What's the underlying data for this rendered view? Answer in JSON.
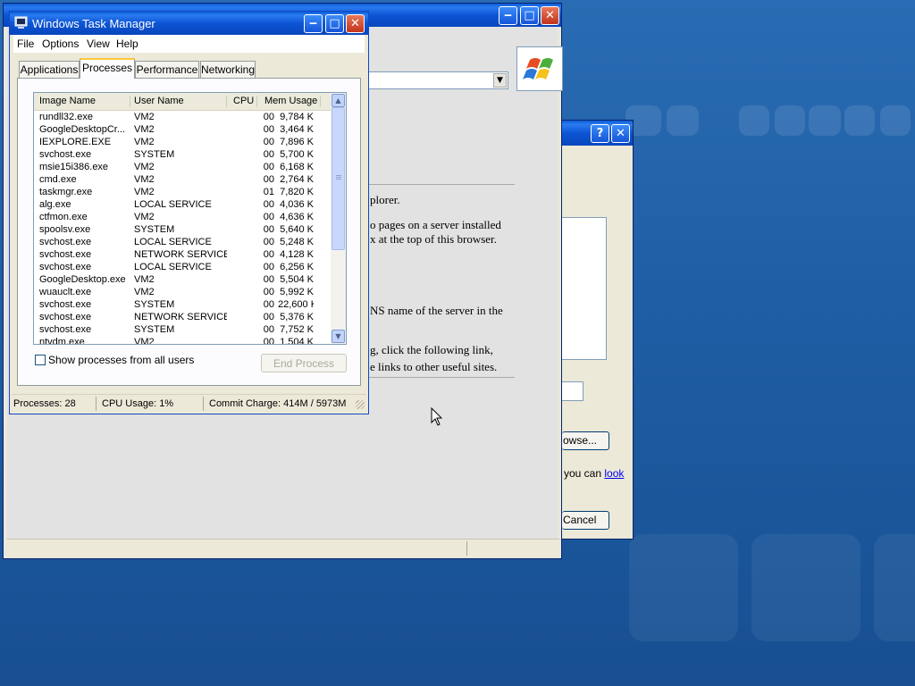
{
  "task_manager": {
    "title": "Windows Task Manager",
    "menu": [
      "File",
      "Options",
      "View",
      "Help"
    ],
    "tabs": [
      "Applications",
      "Processes",
      "Performance",
      "Networking"
    ],
    "active_tab": "Processes",
    "columns": [
      "Image Name",
      "User Name",
      "CPU",
      "Mem Usage"
    ],
    "processes": [
      {
        "name": "rundll32.exe",
        "user": "VM2",
        "cpu": "00",
        "mem": "9,784 K"
      },
      {
        "name": "GoogleDesktopCr...",
        "user": "VM2",
        "cpu": "00",
        "mem": "3,464 K"
      },
      {
        "name": "IEXPLORE.EXE",
        "user": "VM2",
        "cpu": "00",
        "mem": "7,896 K"
      },
      {
        "name": "svchost.exe",
        "user": "SYSTEM",
        "cpu": "00",
        "mem": "5,700 K"
      },
      {
        "name": "msie15i386.exe",
        "user": "VM2",
        "cpu": "00",
        "mem": "6,168 K"
      },
      {
        "name": "cmd.exe",
        "user": "VM2",
        "cpu": "00",
        "mem": "2,764 K"
      },
      {
        "name": "taskmgr.exe",
        "user": "VM2",
        "cpu": "01",
        "mem": "7,820 K"
      },
      {
        "name": "alg.exe",
        "user": "LOCAL SERVICE",
        "cpu": "00",
        "mem": "4,036 K"
      },
      {
        "name": "ctfmon.exe",
        "user": "VM2",
        "cpu": "00",
        "mem": "4,636 K"
      },
      {
        "name": "spoolsv.exe",
        "user": "SYSTEM",
        "cpu": "00",
        "mem": "5,640 K"
      },
      {
        "name": "svchost.exe",
        "user": "LOCAL SERVICE",
        "cpu": "00",
        "mem": "5,248 K"
      },
      {
        "name": "svchost.exe",
        "user": "NETWORK SERVICE",
        "cpu": "00",
        "mem": "4,128 K"
      },
      {
        "name": "svchost.exe",
        "user": "LOCAL SERVICE",
        "cpu": "00",
        "mem": "6,256 K"
      },
      {
        "name": "GoogleDesktop.exe",
        "user": "VM2",
        "cpu": "00",
        "mem": "5,504 K"
      },
      {
        "name": "wuauclt.exe",
        "user": "VM2",
        "cpu": "00",
        "mem": "5,992 K"
      },
      {
        "name": "svchost.exe",
        "user": "SYSTEM",
        "cpu": "00",
        "mem": "22,600 K"
      },
      {
        "name": "svchost.exe",
        "user": "NETWORK SERVICE",
        "cpu": "00",
        "mem": "5,376 K"
      },
      {
        "name": "svchost.exe",
        "user": "SYSTEM",
        "cpu": "00",
        "mem": "7,752 K"
      },
      {
        "name": "ntvdm.exe",
        "user": "VM2",
        "cpu": "00",
        "mem": "1,504 K"
      }
    ],
    "show_all_users_label": "Show processes from all users",
    "show_all_users_checked": false,
    "end_process_label": "End Process",
    "status": {
      "processes": "Processes: 28",
      "cpu_usage": "CPU Usage: 1%",
      "commit_charge": "Commit Charge: 414M / 5973M"
    }
  },
  "browser_window": {
    "text_lines": [
      "plorer.",
      "o pages on a server installed",
      "x at the top of this browser.",
      "NS name of the server in the",
      "g, click the following link,",
      "e links to other useful sites."
    ]
  },
  "dialog": {
    "help_glyph": "?",
    "close_glyph": "✕",
    "browse_label": "owse...",
    "link_prefix": "you can ",
    "link_text": "look",
    "cancel_label": "Cancel"
  },
  "colors": {
    "titlebar_blue": "#0c55d4",
    "desktop_blue": "#1f5fa6",
    "link_blue": "#0000ee"
  }
}
